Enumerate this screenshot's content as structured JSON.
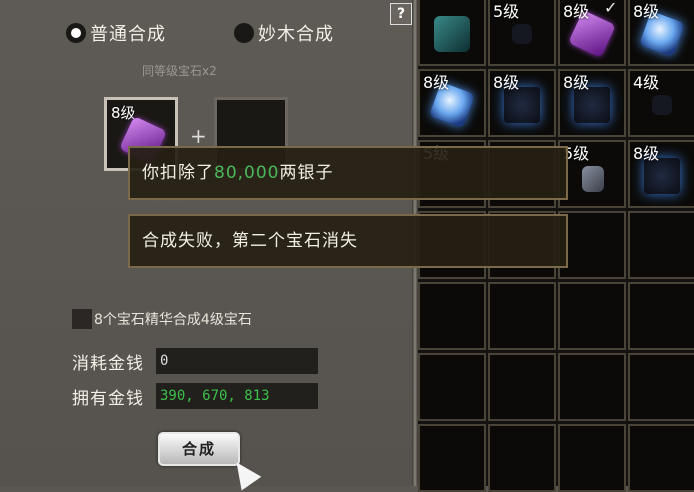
{
  "synthesis": {
    "help_label": "?",
    "modes": [
      {
        "label": "普通合成",
        "selected": true
      },
      {
        "label": "妙木合成",
        "selected": false
      }
    ],
    "subtitle": "同等级宝石x2",
    "slot1_level": "8级",
    "slot2_level": "",
    "plus": "+",
    "faded_text": "………",
    "essence_checkbox_label": "8个宝石精华合成4级宝石",
    "cost_label": "消耗金钱",
    "cost_value": "0",
    "owned_label": "拥有金钱",
    "owned_value": "390, 670, 813",
    "compose_button": "合成"
  },
  "messages": {
    "deduct_prefix": "你扣除了",
    "deduct_amount": "80,000",
    "deduct_suffix": "两银子",
    "result": "合成失败，第二个宝石消失"
  },
  "inventory": [
    {
      "level": "",
      "gem": "teal"
    },
    {
      "level": "5级",
      "gem": "dark"
    },
    {
      "level": "8级",
      "gem": "purple",
      "checked": true,
      "check": "✓"
    },
    {
      "level": "8级",
      "gem": "blue"
    },
    {
      "level": "8级",
      "gem": "blue"
    },
    {
      "level": "8级",
      "gem": "box"
    },
    {
      "level": "8级",
      "gem": "box"
    },
    {
      "level": "4级",
      "gem": "dark"
    },
    {
      "level": "5级",
      "gem": ""
    },
    {
      "level": "",
      "gem": ""
    },
    {
      "level": "5级",
      "gem": "grey"
    },
    {
      "level": "8级",
      "gem": "box"
    }
  ]
}
